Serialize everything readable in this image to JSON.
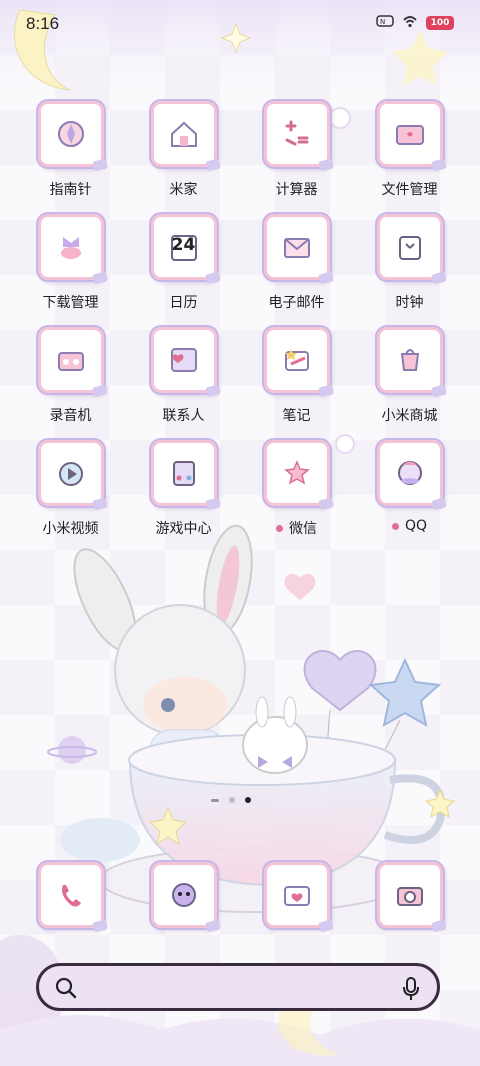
{
  "status_bar": {
    "time": "8:16",
    "battery_level": "100",
    "icons": [
      "nfc-icon",
      "wifi-icon",
      "battery-icon"
    ]
  },
  "apps": [
    {
      "label": "指南针",
      "icon": "compass-icon",
      "dot": false
    },
    {
      "label": "米家",
      "icon": "home-icon",
      "dot": false
    },
    {
      "label": "计算器",
      "icon": "calculator-icon",
      "dot": false
    },
    {
      "label": "文件管理",
      "icon": "folder-icon",
      "dot": false
    },
    {
      "label": "下载管理",
      "icon": "download-icon",
      "dot": false
    },
    {
      "label": "日历",
      "icon": "calendar-icon",
      "dot": false,
      "badge": "24"
    },
    {
      "label": "电子邮件",
      "icon": "mail-icon",
      "dot": false
    },
    {
      "label": "时钟",
      "icon": "clock-icon",
      "dot": false
    },
    {
      "label": "录音机",
      "icon": "recorder-icon",
      "dot": false
    },
    {
      "label": "联系人",
      "icon": "contacts-icon",
      "dot": false
    },
    {
      "label": "笔记",
      "icon": "notes-icon",
      "dot": false
    },
    {
      "label": "小米商城",
      "icon": "shop-icon",
      "dot": false
    },
    {
      "label": "小米视频",
      "icon": "video-icon",
      "dot": false
    },
    {
      "label": "游戏中心",
      "icon": "game-icon",
      "dot": false
    },
    {
      "label": "微信",
      "icon": "wechat-icon",
      "dot": true
    },
    {
      "label": "QQ",
      "icon": "qq-icon",
      "dot": true
    }
  ],
  "dock": [
    {
      "icon": "phone-icon"
    },
    {
      "icon": "messages-icon"
    },
    {
      "icon": "gallery-icon"
    },
    {
      "icon": "camera-icon"
    }
  ],
  "page_indicator": {
    "pages": 3,
    "active": 3
  },
  "colors": {
    "accent_pink": "#f5c3d6",
    "accent_lavender": "#c7b7e8",
    "dot": "#e36f94",
    "search_bg": "#ede2f3"
  },
  "search": {
    "icons": [
      "search-icon",
      "mic-icon"
    ]
  }
}
